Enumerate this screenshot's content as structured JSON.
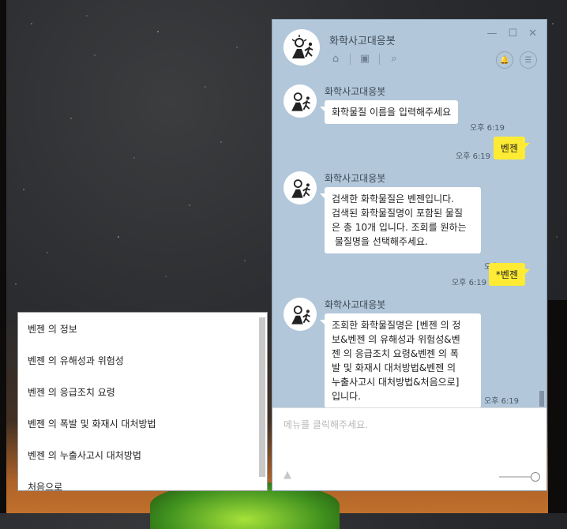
{
  "window": {
    "title": "화학사고대응봇",
    "controls": [
      "—",
      "☐",
      "✕"
    ],
    "header_icons": [
      "home-icon",
      "inbox-icon",
      "search-icon"
    ],
    "bell_icon": "🔔",
    "menu_icon": "☰"
  },
  "messages": [
    {
      "sender": "화학사고대응봇",
      "text": "화학물질 이름을 입력해주세요",
      "time": "오후 6:19"
    },
    {
      "sender": "me",
      "text": "벤젠",
      "time": "오후 6:19"
    },
    {
      "sender": "화학사고대응봇",
      "lines": [
        "검색한 화학물질은 벤젠입니다.",
        "검색된 화학물질명이 포함된 물질",
        "은 총 10개 입니다. 조회를 원하는",
        " 물질명을 선택해주세요."
      ],
      "time": "오후 6:19"
    },
    {
      "sender": "me",
      "text": "*벤젠",
      "time": "오후 6:19"
    },
    {
      "sender": "화학사고대응봇",
      "lines": [
        "조회한 화학물질명은 [벤젠 의 정",
        "보&벤젠 의 유해성과 위험성&벤",
        "젠 의 응급조치 요령&벤젠 의 폭",
        "발 및 화재시 대처방법&벤젠 의",
        "누출사고시 대처방법&처음으로]",
        "입니다."
      ],
      "time": "오후 6:19"
    }
  ],
  "input": {
    "placeholder": "메뉴를 클릭해주세요."
  },
  "menu": {
    "items": [
      "벤젠 의 정보",
      "벤젠 의 유해성과 위험성",
      "벤젠 의 응급조치 요령",
      "벤젠 의 폭발 및 화재시 대처방법",
      "벤젠 의 누출사고시 대처방법",
      "처음으로"
    ]
  },
  "colors": {
    "chat_bg": "#b2c7da",
    "my_bubble": "#ffeb33",
    "bot_bubble": "#ffffff"
  }
}
